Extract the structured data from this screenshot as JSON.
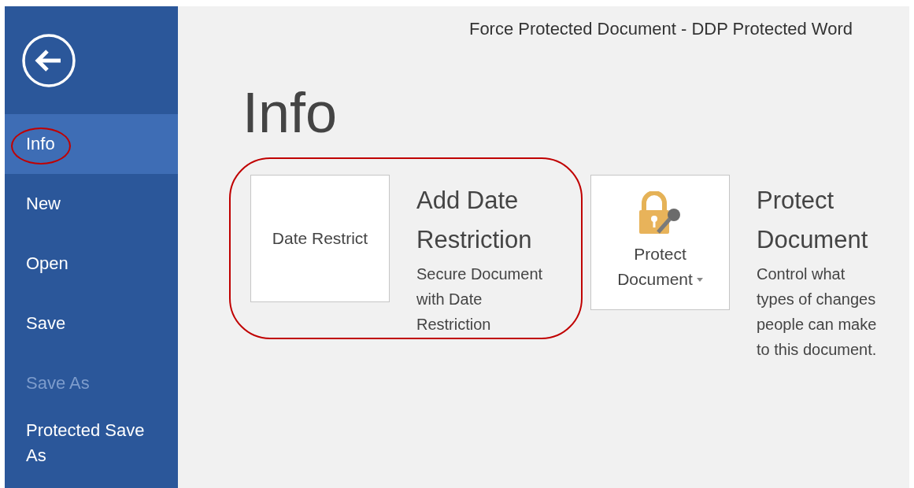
{
  "window": {
    "title": "Force Protected Document - DDP Protected Word"
  },
  "sidebar": {
    "items": [
      {
        "label": "Info",
        "selected": true,
        "disabled": false,
        "highlighted": true
      },
      {
        "label": "New",
        "selected": false,
        "disabled": false,
        "highlighted": false
      },
      {
        "label": "Open",
        "selected": false,
        "disabled": false,
        "highlighted": false
      },
      {
        "label": "Save",
        "selected": false,
        "disabled": false,
        "highlighted": false
      },
      {
        "label": "Save As",
        "selected": false,
        "disabled": true,
        "highlighted": false
      },
      {
        "label": "Protected Save As",
        "selected": false,
        "disabled": false,
        "highlighted": false
      }
    ]
  },
  "heading": "Info",
  "options": [
    {
      "kind": "plain",
      "button_label": [
        "Date Restrict"
      ],
      "dropdown": false,
      "title": "Add Date Restriction",
      "description": "Secure Document with Date Restriction",
      "highlighted": true
    },
    {
      "kind": "lock",
      "button_label": [
        "Protect",
        "Document"
      ],
      "dropdown": true,
      "title": "Protect Document",
      "description": "Control what types of changes people can make to this document.",
      "highlighted": false
    }
  ]
}
